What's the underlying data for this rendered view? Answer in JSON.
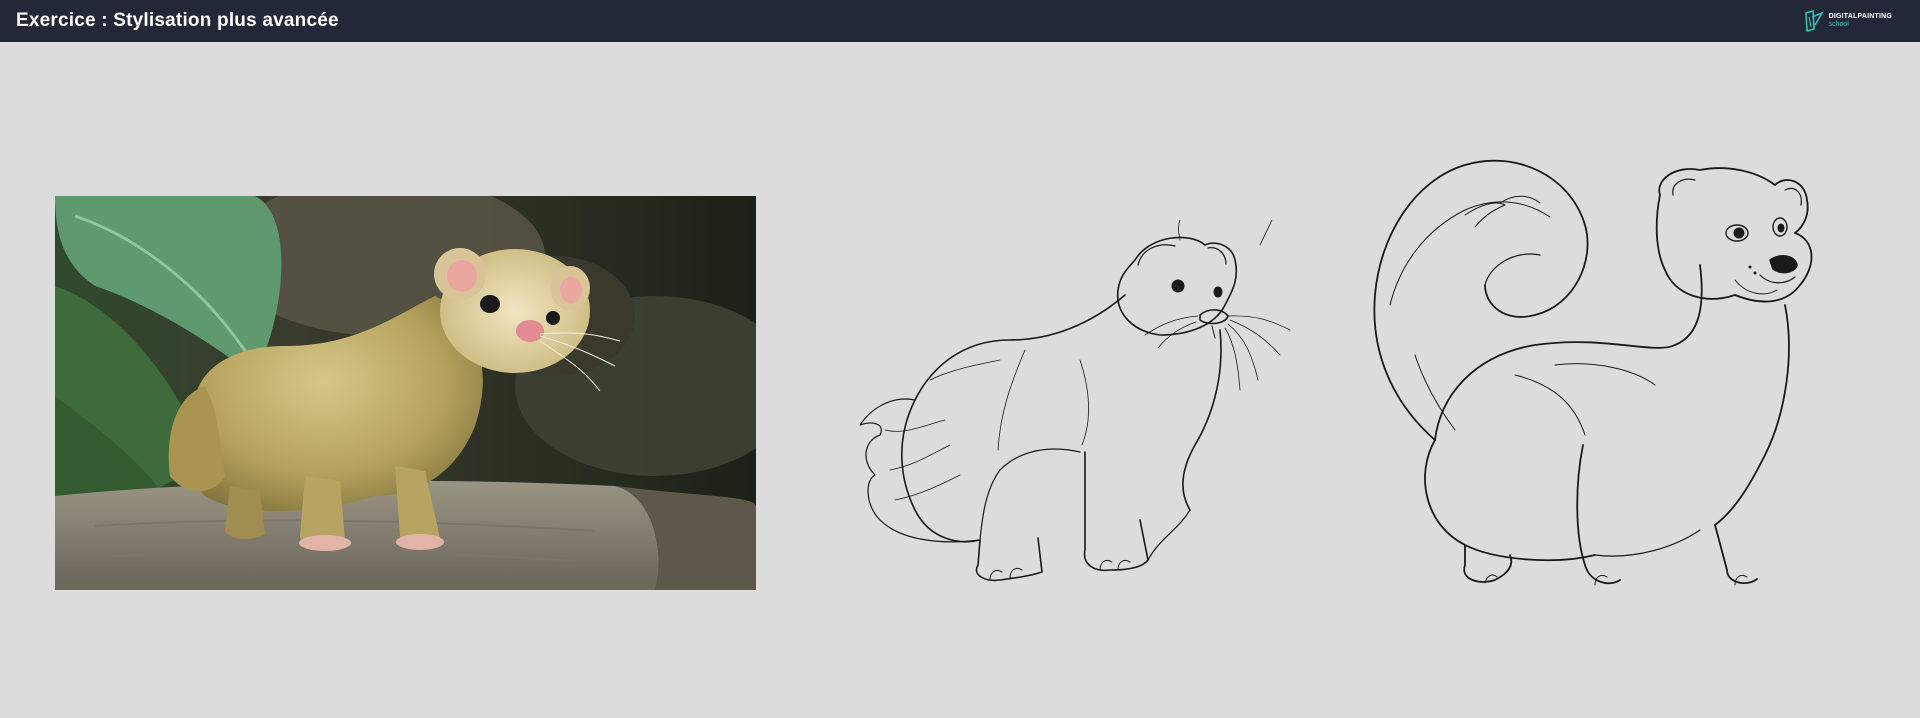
{
  "header": {
    "title": "Exercice : Stylisation plus avancée",
    "logo": {
      "icon": "brush-leaf-icon",
      "brand": "DIGITALPAINTING",
      "sub": "school",
      "accent": "#2ec4b6"
    }
  },
  "colors": {
    "header_bg": "#222838",
    "canvas_bg": "#dcdcdc",
    "line": "#1a1a1a"
  },
  "images": [
    {
      "name": "ferret-photo"
    },
    {
      "name": "ferret-sketch-realistic"
    },
    {
      "name": "ferret-sketch-stylized"
    }
  ]
}
